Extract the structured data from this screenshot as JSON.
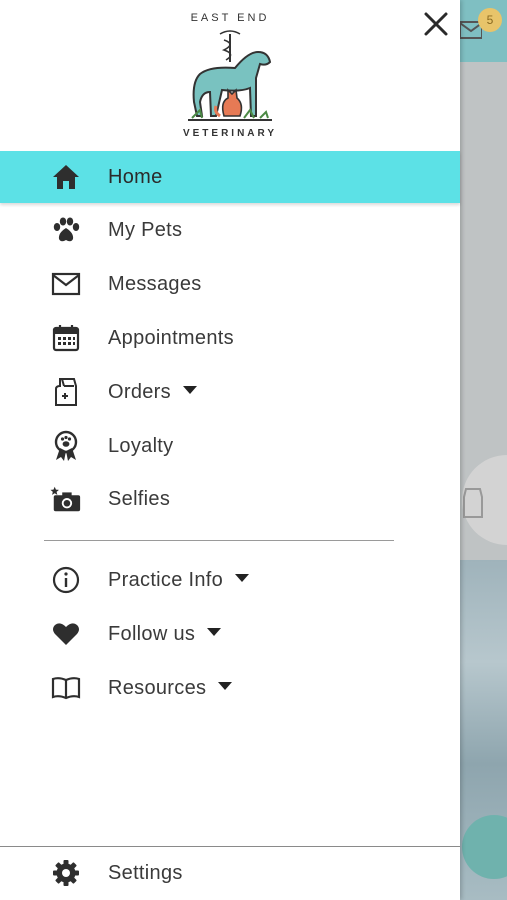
{
  "background": {
    "badge_count": "5"
  },
  "brand": {
    "logo_top_text": "EAST END",
    "logo_bottom_text": "VETERINARY"
  },
  "menu": {
    "items": [
      {
        "label": "Home",
        "icon": "home-icon",
        "active": true
      },
      {
        "label": "My Pets",
        "icon": "paw-icon"
      },
      {
        "label": "Messages",
        "icon": "envelope-icon"
      },
      {
        "label": "Appointments",
        "icon": "calendar-icon"
      },
      {
        "label": "Orders",
        "icon": "pet-food-bag-icon",
        "has_dropdown": true
      },
      {
        "label": "Loyalty",
        "icon": "award-ribbon-icon"
      },
      {
        "label": "Selfies",
        "icon": "camera-icon"
      }
    ],
    "secondary": [
      {
        "label": "Practice Info",
        "icon": "info-icon",
        "has_dropdown": true
      },
      {
        "label": "Follow us",
        "icon": "heart-icon",
        "has_dropdown": true
      },
      {
        "label": "Resources",
        "icon": "book-icon",
        "has_dropdown": true
      }
    ],
    "settings": {
      "label": "Settings",
      "icon": "gear-icon"
    }
  },
  "colors": {
    "active_highlight": "#5ce1e6",
    "icon": "#3a3a3a",
    "drawer_bg": "#ffffff"
  }
}
